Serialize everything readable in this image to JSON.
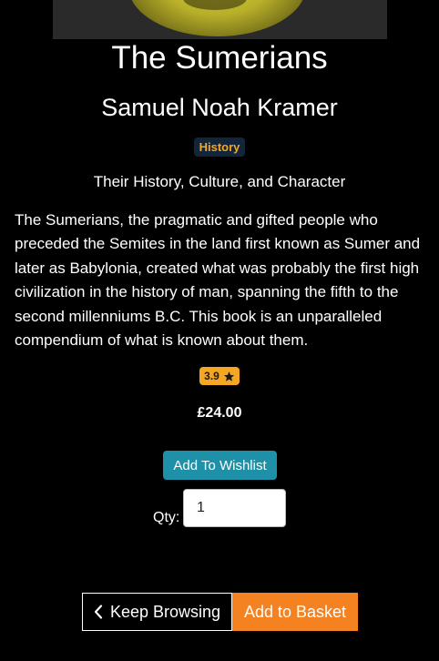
{
  "book": {
    "title": "The Sumerians",
    "author": "Samuel Noah Kramer",
    "category": "History",
    "subtitle": "Their History, Culture, and Character",
    "description": "The Sumerians, the pragmatic and gifted people who preceded the Semites in the land first known as Sumer and later as Babylonia, created what was probably the first high civilization in the history of man, spanning the fifth to the second millenniums B.C. This book is an unparalleled compendium of what is known about them.",
    "rating": "3.9",
    "rating_icon": "star-icon",
    "price": "£24.00"
  },
  "actions": {
    "wishlist_label": "Add To Wishlist",
    "qty_label": "Qty:",
    "qty_value": "1",
    "keep_browsing_label": "Keep Browsing",
    "keep_browsing_icon": "chevron-left-icon",
    "add_to_basket_label": "Add to Basket"
  },
  "colors": {
    "background": "#000000",
    "badge_bg": "#12253b",
    "badge_text": "#f5a623",
    "rating_bg": "#f5a623",
    "wishlist_bg": "#1e90a8",
    "basket_bg": "#f58220"
  }
}
